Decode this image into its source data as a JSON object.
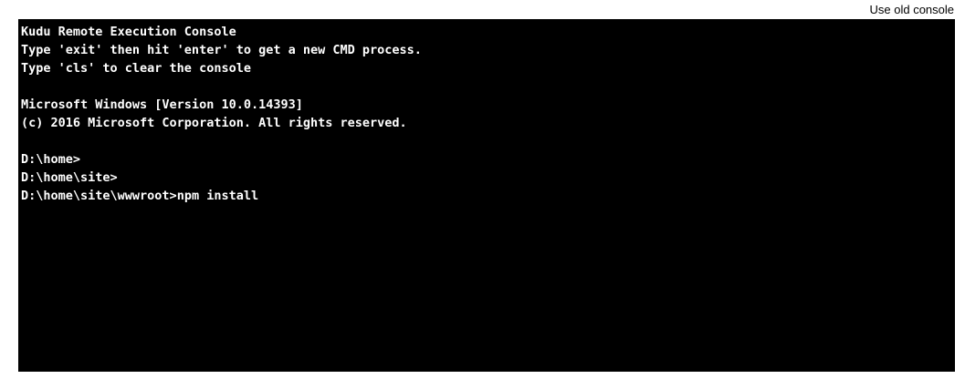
{
  "header": {
    "old_console_link": "Use old console"
  },
  "console": {
    "banner": [
      "Kudu Remote Execution Console",
      "Type 'exit' then hit 'enter' to get a new CMD process.",
      "Type 'cls' to clear the console"
    ],
    "system": [
      "Microsoft Windows [Version 10.0.14393]",
      "(c) 2016 Microsoft Corporation. All rights reserved."
    ],
    "history": [
      "D:\\home>",
      "D:\\home\\site>"
    ],
    "current_prompt": "D:\\home\\site\\wwwroot>",
    "current_command": "npm install"
  },
  "colors": {
    "console_background": "#000000",
    "console_text": "#ffffff",
    "page_background": "#ffffff"
  }
}
